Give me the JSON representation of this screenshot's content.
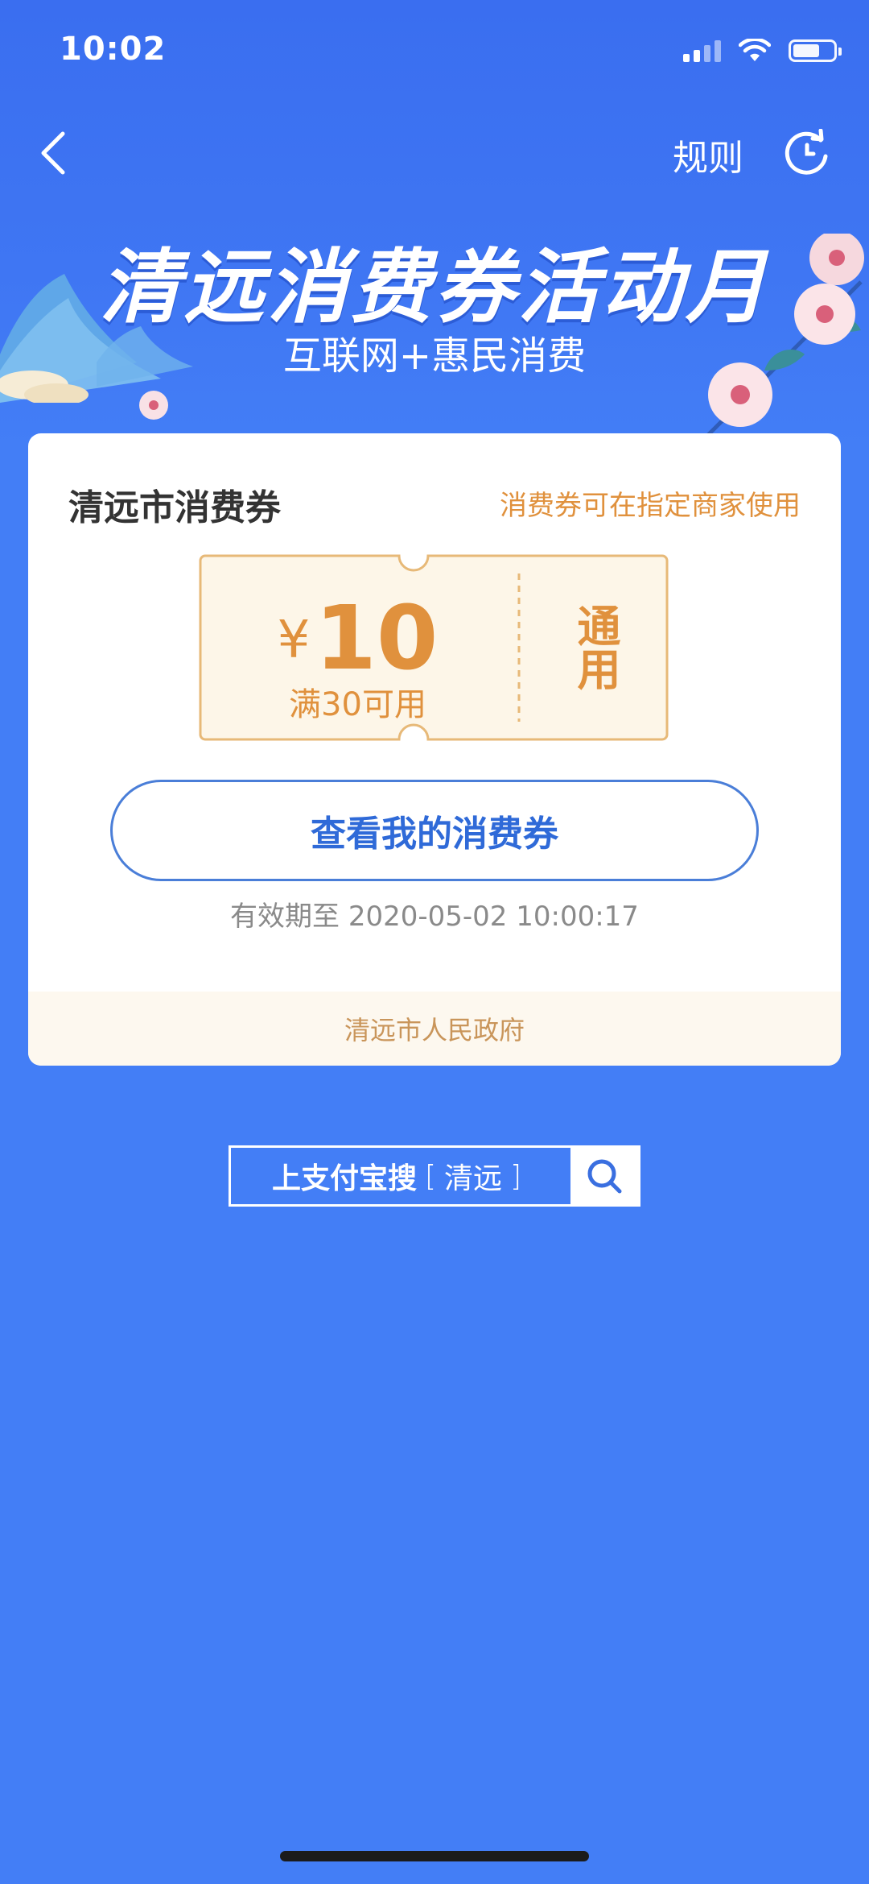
{
  "status_bar": {
    "time": "10:02"
  },
  "nav": {
    "back_icon": "chevron-left-icon",
    "rules_label": "规则",
    "refresh_icon": "refresh-icon"
  },
  "banner": {
    "title": "清远消费券活动月",
    "subtitle": "互联网+惠民消费"
  },
  "card": {
    "title": "清远市消费券",
    "note": "消费券可在指定商家使用",
    "coupon": {
      "currency": "¥",
      "amount": "10",
      "condition": "满30可用",
      "type": "通用"
    },
    "view_button": "查看我的消费券",
    "validity": "有效期至 2020-05-02 10:00:17",
    "issuer": "清远市人民政府"
  },
  "search": {
    "prefix": "上支付宝搜",
    "bracket_open": "[",
    "keyword": "清远",
    "bracket_close": "]",
    "icon": "search-icon"
  },
  "colors": {
    "background": "#437ef6",
    "accent_orange": "#e0913d",
    "button_blue": "#2f6ad8"
  }
}
